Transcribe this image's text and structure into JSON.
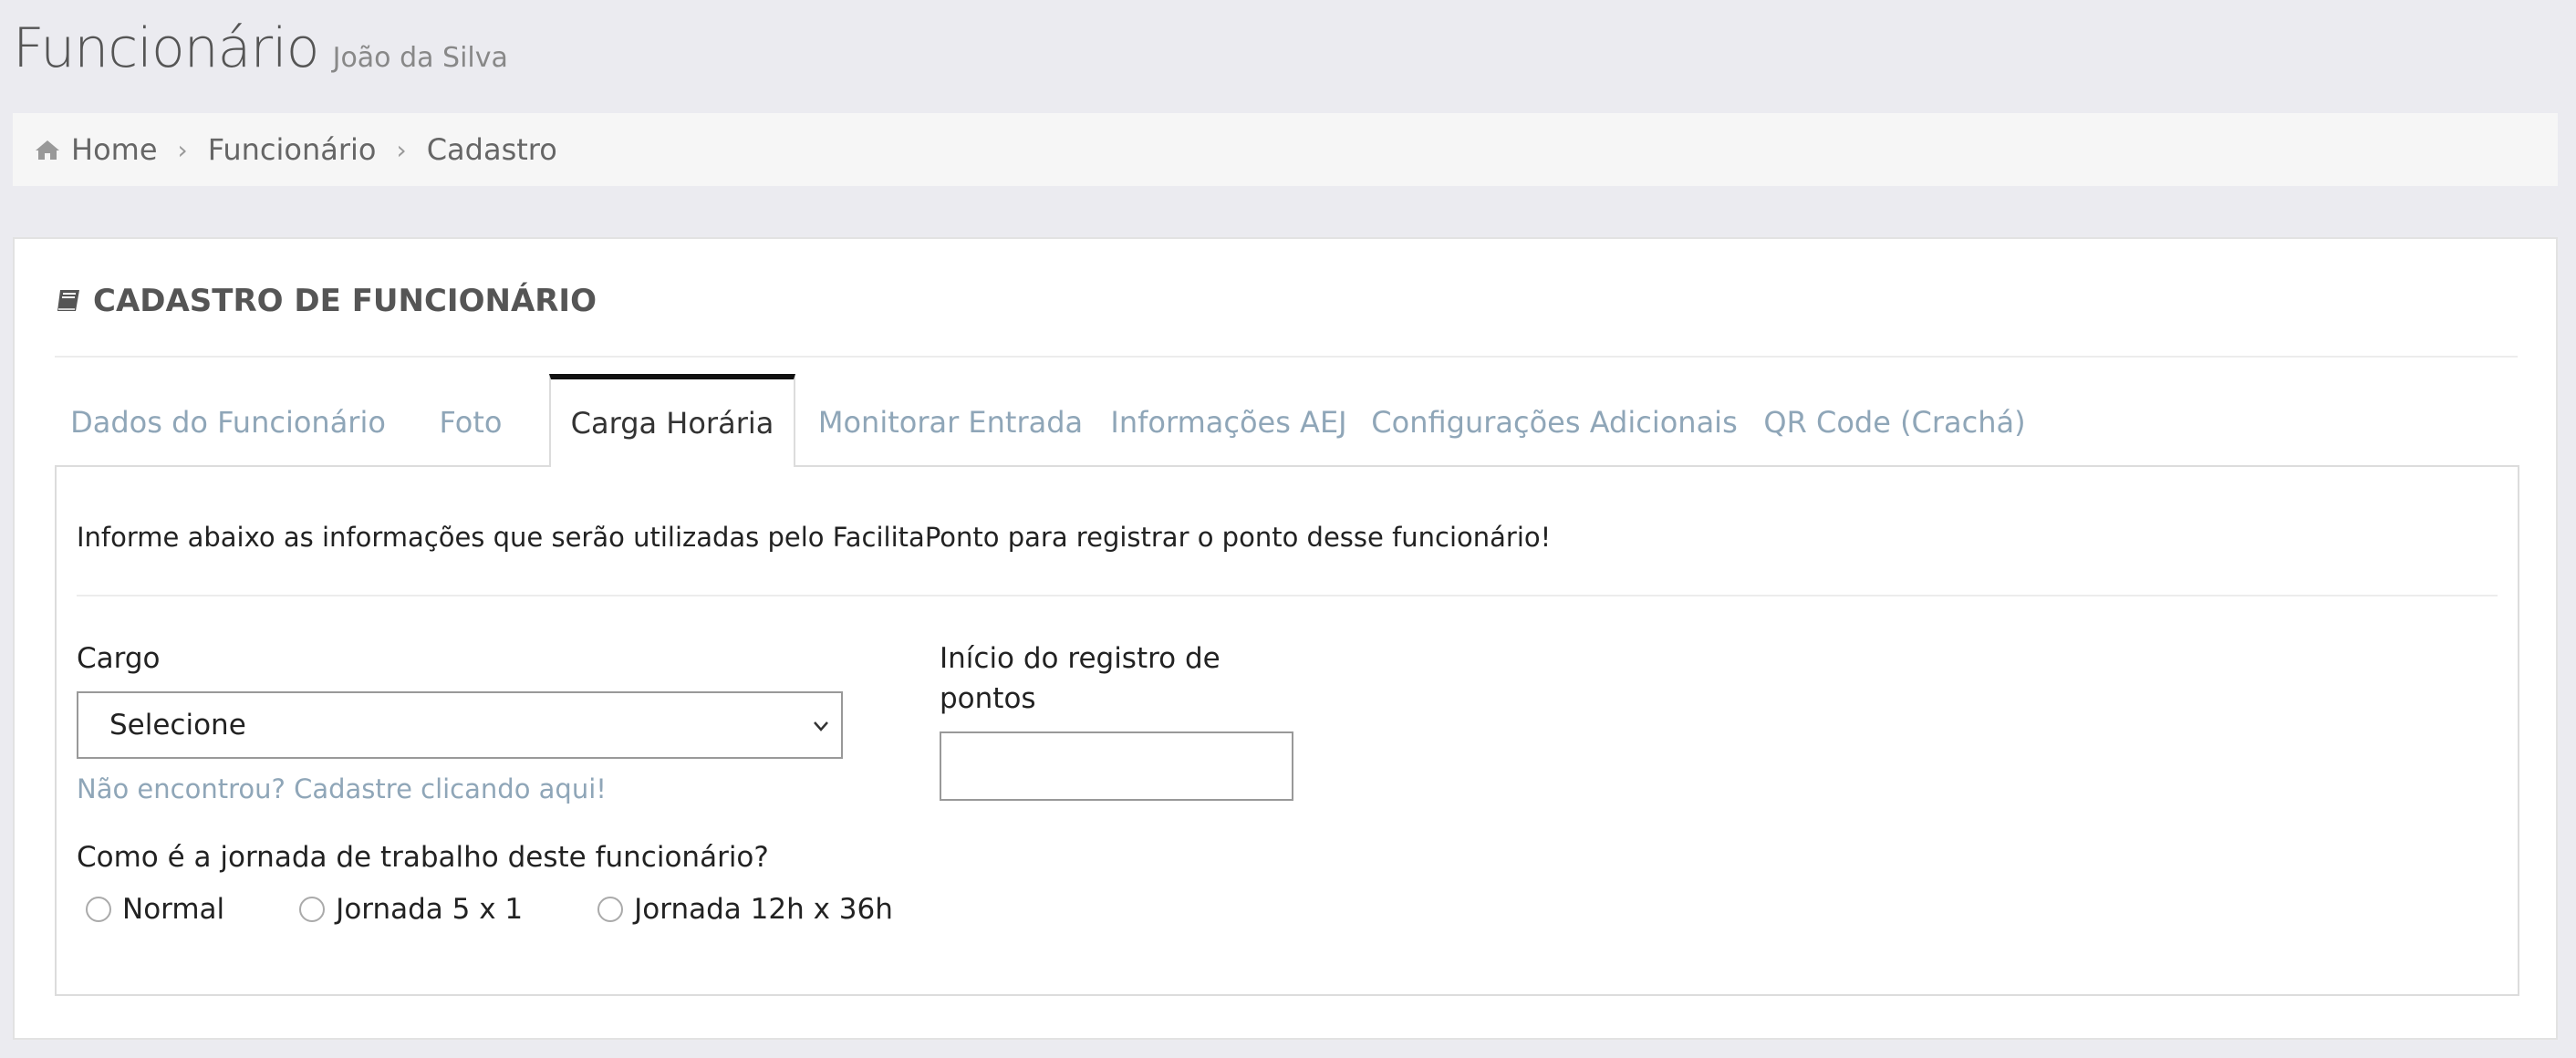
{
  "header": {
    "title": "Funcionário",
    "subtitle": "João da Silva"
  },
  "breadcrumb": {
    "items": [
      "Home",
      "Funcionário",
      "Cadastro"
    ]
  },
  "panel": {
    "heading": "CADASTRO DE FUNCIONÁRIO"
  },
  "tabs": [
    {
      "label": "Dados do Funcionário"
    },
    {
      "label": "Foto"
    },
    {
      "label": "Carga Horária"
    },
    {
      "label": "Monitorar Entrada"
    },
    {
      "label": "Informações AEJ"
    },
    {
      "label": "Configurações Adicionais"
    },
    {
      "label": "QR Code (Crachá)"
    }
  ],
  "active_tab": "Carga Horária",
  "content": {
    "info": "Informe abaixo as informações que serão utilizadas pelo FacilitaPonto para registrar o ponto desse funcionário!",
    "cargo": {
      "label": "Cargo",
      "selected": "Selecione"
    },
    "cargo_link": "Não encontrou? Cadastre clicando aqui!",
    "inicio": {
      "label_line1": "Início do registro de",
      "label_line2": "pontos",
      "value": ""
    },
    "jornada": {
      "question": "Como é a jornada de trabalho deste funcionário?",
      "options": [
        "Normal",
        "Jornada 5 x 1",
        "Jornada 12h x 36h"
      ]
    }
  },
  "colors": {
    "background": "#ebebf0",
    "tab_inactive": "#8fa6b8",
    "link": "#8fa6b8",
    "active_tab_border": "#111111"
  }
}
